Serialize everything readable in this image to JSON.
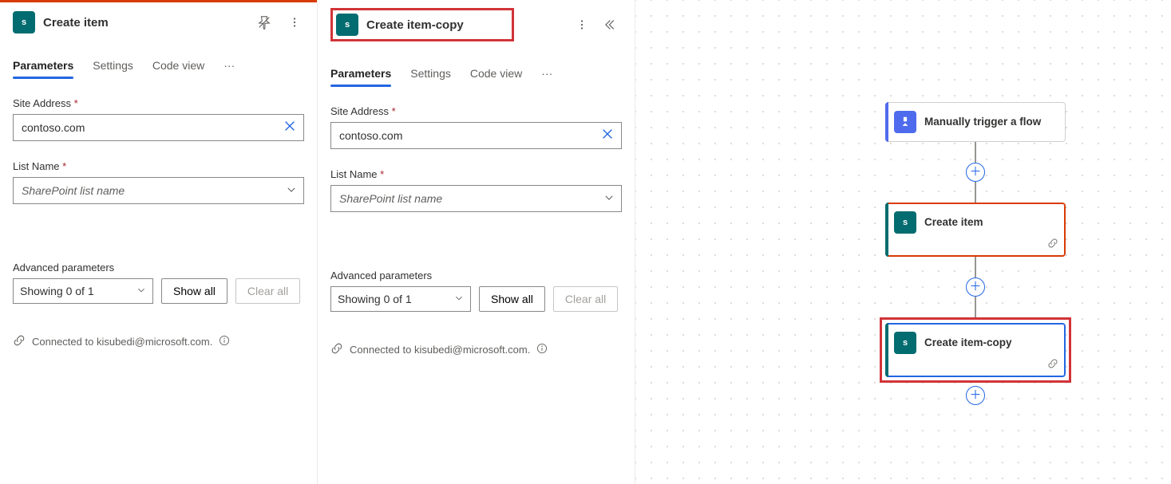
{
  "panel_left": {
    "title": "Create item",
    "tabs": {
      "parameters": "Parameters",
      "settings": "Settings",
      "codeview": "Code view"
    },
    "site_label": "Site Address",
    "site_value": "contoso.com",
    "list_label": "List Name",
    "list_placeholder": "SharePoint list name",
    "adv_label": "Advanced parameters",
    "adv_select": "Showing 0 of 1",
    "show_all": "Show all",
    "clear_all": "Clear all",
    "connected": "Connected to kisubedi@microsoft.com."
  },
  "panel_right": {
    "title": "Create item-copy",
    "tabs": {
      "parameters": "Parameters",
      "settings": "Settings",
      "codeview": "Code view"
    },
    "site_label": "Site Address",
    "site_value": "contoso.com",
    "list_label": "List Name",
    "list_placeholder": "SharePoint list name",
    "adv_label": "Advanced parameters",
    "adv_select": "Showing 0 of 1",
    "show_all": "Show all",
    "clear_all": "Clear all",
    "connected": "Connected to kisubedi@microsoft.com."
  },
  "canvas": {
    "trigger": "Manually trigger a flow",
    "action1": "Create item",
    "action2": "Create item-copy"
  }
}
